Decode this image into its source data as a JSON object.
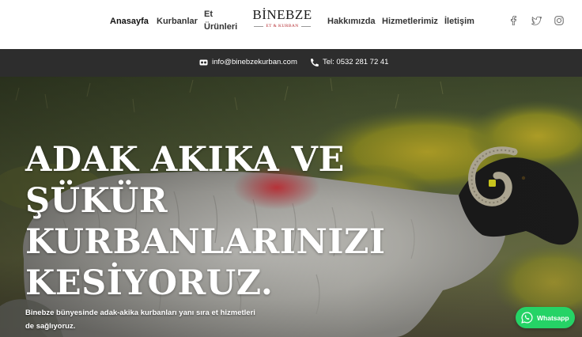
{
  "nav": {
    "items": [
      {
        "label": "Anasayfa",
        "active": true
      },
      {
        "label": "Kurbanlar"
      },
      {
        "label": "Et Ürünleri"
      },
      {
        "label": "Hakkımızda"
      },
      {
        "label": "Hizmetlerimiz"
      },
      {
        "label": "İletişim"
      }
    ]
  },
  "logo": {
    "name": "BİNEBZE",
    "tagline": "ET & KURBAN"
  },
  "social": [
    "facebook-icon",
    "twitter-icon",
    "instagram-icon"
  ],
  "contact": {
    "email": "info@binebzekurban.com",
    "phone": "Tel: 0532 281 72 41"
  },
  "hero": {
    "title_lines": [
      "ADAK AKIKA VE",
      "ŞÜKÜR",
      "KURBANLARINIZI",
      "KESİYORUZ."
    ],
    "description": "Binebze bünyesinde adak-akika kurbanları yanı sıra et hizmetleri de sağlıyoruz."
  },
  "whatsapp": {
    "label": "Whatsapp",
    "color": "#25d366"
  },
  "colors": {
    "contact_bar": "#2d2d2d",
    "logo_accent": "#b3262b"
  }
}
